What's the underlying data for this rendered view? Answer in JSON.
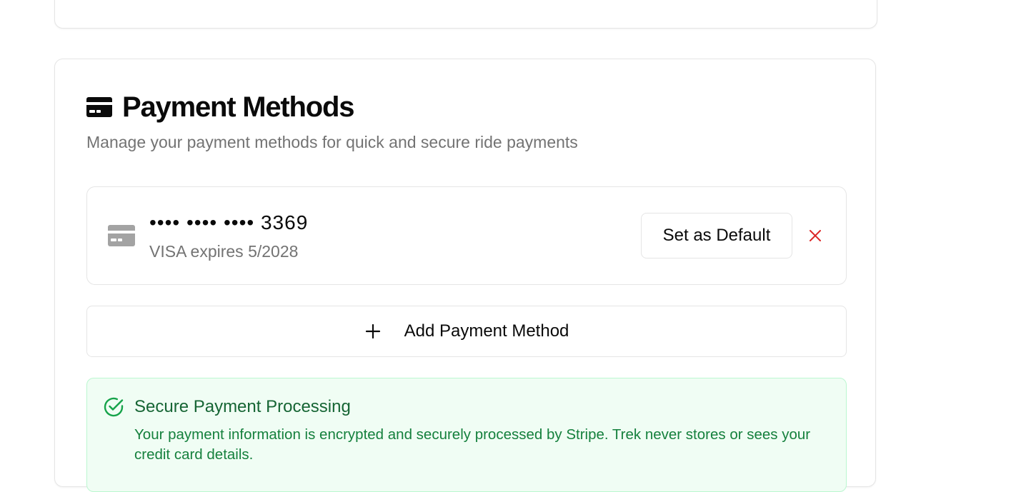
{
  "payment_methods": {
    "title": "Payment Methods",
    "title_icon": "credit-card-icon",
    "subtitle": "Manage your payment methods for quick and secure ride payments",
    "methods": [
      {
        "masked_number": "•••• •••• •••• 3369",
        "details": "VISA expires 5/2028",
        "icon": "credit-card-icon",
        "set_default_label": "Set as Default",
        "remove_icon": "close-icon"
      }
    ],
    "add_button_label": "Add Payment Method",
    "add_icon": "plus-icon",
    "secure_notice": {
      "icon": "check-circle-icon",
      "title": "Secure Payment Processing",
      "text": "Your payment information is encrypted and securely processed by Stripe. Trek never stores or sees your credit card details."
    }
  },
  "colors": {
    "success_bg": "#f0fdf4",
    "success_border": "#bbf7d0",
    "success_text": "#15803d",
    "danger": "#dc2626",
    "muted": "#737373"
  }
}
